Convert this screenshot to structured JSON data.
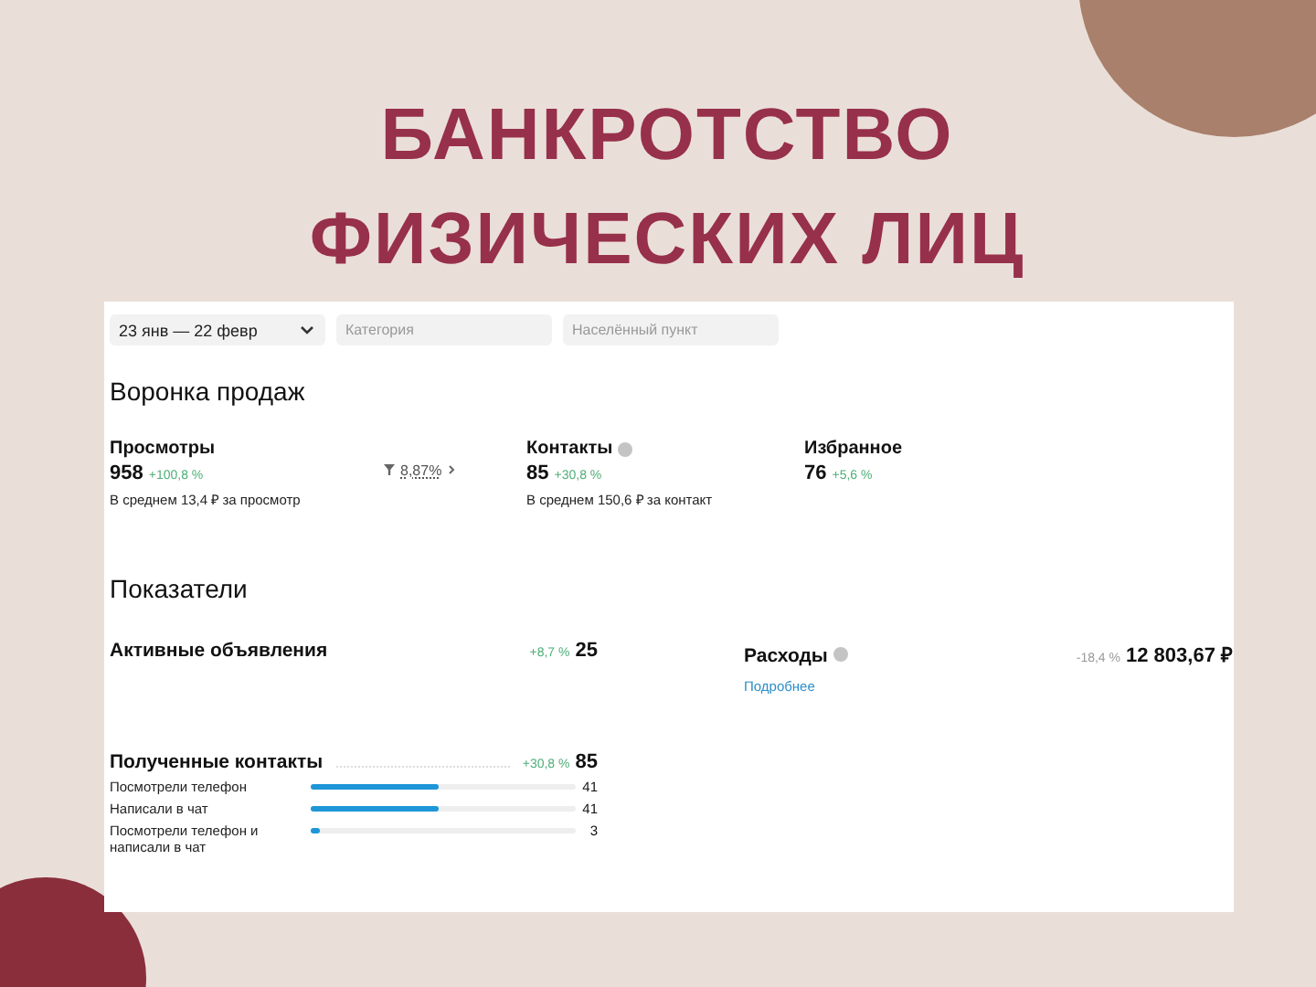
{
  "headline": [
    "БАНКРОТСТВО",
    "ФИЗИЧЕСКИХ ЛИЦ"
  ],
  "filters": [
    {
      "kind": "select",
      "value": "23 янв — 22 февр"
    },
    {
      "kind": "input",
      "placeholder": "Категория"
    },
    {
      "kind": "input",
      "placeholder": "Населённый пункт"
    }
  ],
  "funnel": {
    "title": "Воронка продаж",
    "conversion": "8,87%",
    "items": [
      {
        "label": "Просмотры",
        "info": false,
        "value": "958",
        "delta": "+100,8 %",
        "color": "#4fae78",
        "note": "В среднем 13,4 ₽ за просмотр"
      },
      {
        "label": "Контакты",
        "info": true,
        "value": "85",
        "delta": "+30,8 %",
        "color": "#4fae78",
        "note": "В среднем 150,6 ₽ за контакт"
      },
      {
        "label": "Избранное",
        "info": false,
        "value": "76",
        "delta": "+5,6 %",
        "color": "#4fae78"
      }
    ]
  },
  "indicators": {
    "title": "Показатели",
    "active": {
      "label": "Активные объявления",
      "delta": "+8,7 %",
      "color": "#4fae78",
      "value": "25"
    },
    "expenses": {
      "label": "Расходы",
      "info": true,
      "delta": "-18,4 %",
      "color": "#999999",
      "value": "12 803,67 ₽",
      "link": "Подробнее"
    },
    "contacts": {
      "label": "Полученные контакты",
      "delta": "+30,8 %",
      "color": "#4fae78",
      "value": "85",
      "rows": [
        {
          "label": "Посмотрели телефон",
          "level": 0.48,
          "value": "41"
        },
        {
          "label": "Написали в чат",
          "level": 0.48,
          "value": "41"
        },
        {
          "label": "Посмотрели телефон и написали в чат",
          "level": 0.035,
          "value": "3"
        }
      ]
    }
  }
}
